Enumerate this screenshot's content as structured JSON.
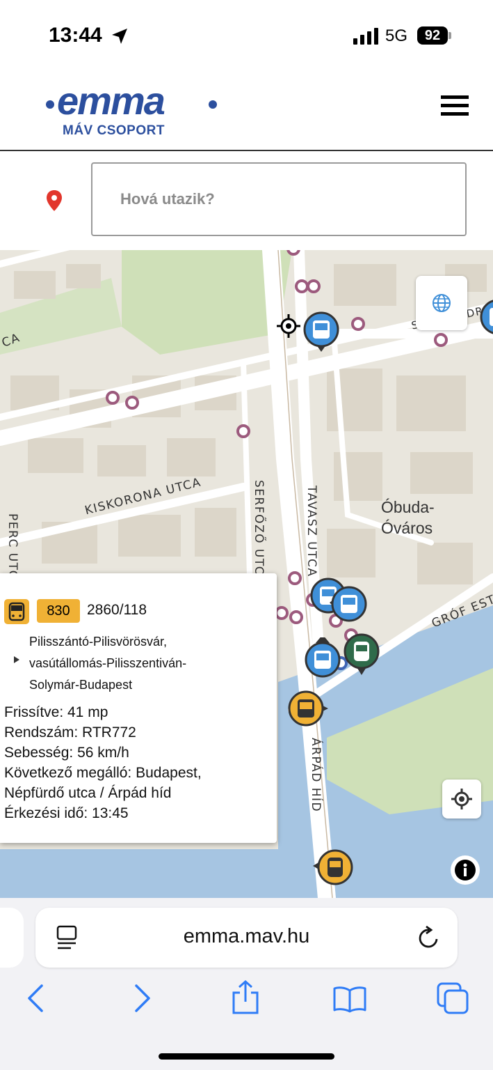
{
  "status_bar": {
    "time": "13:44",
    "network": "5G",
    "battery": "92"
  },
  "header": {
    "logo_word": "emma",
    "logo_sub": "MÁV CSOPORT"
  },
  "search": {
    "placeholder": "Hová utazik?"
  },
  "map": {
    "labels": {
      "kiskorona": "KISKORONA UTCA",
      "perc": "PERC UTCA",
      "serfozo": "SERFŐZŐ UTCA",
      "tavasz": "TAVASZ UTCA",
      "obuda_1": "Óbuda-",
      "obuda_2": "Óváros",
      "grof": "GRÓF ESTER",
      "arpad": "ÁRPÁD HÍD",
      "szentendrei": "SZENTENDREI",
      "ca": "CA",
      "ca2": "CA"
    }
  },
  "popup": {
    "route": "830",
    "trip_id": "2860/118",
    "route_lines": [
      "Pilisszántó-Pilisvörösvár,",
      "vasútállomás-Pilisszentiván-",
      "Solymár-Budapest"
    ],
    "details": [
      "Frissítve: 41 mp",
      "Rendszám: RTR772",
      "Sebesség: 56 km/h",
      "Következő megálló: Budapest,",
      "Népfürdő utca / Árpád híd",
      "Érkezési idő: 13:45"
    ]
  },
  "browser": {
    "url": "emma.mav.hu"
  },
  "colors": {
    "brand": "#2c4f9e",
    "bus_blue": "#3f8fd8",
    "bus_yellow": "#f0b135",
    "tram_green": "#2f6b4a",
    "stop_purple": "#9c5a7d",
    "water": "#a6c5e2",
    "park": "#cfe0b8"
  }
}
